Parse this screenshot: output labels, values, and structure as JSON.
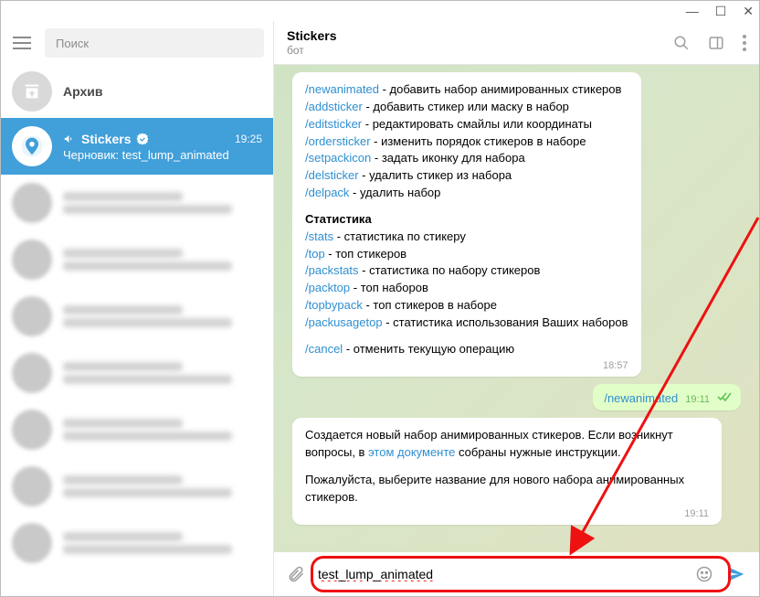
{
  "titlebar": {
    "min": "—",
    "max": "☐",
    "close": "✕"
  },
  "sidebar": {
    "search_placeholder": "Поиск",
    "archive": "Архив",
    "active_chat": {
      "name": "Stickers",
      "time": "19:25",
      "draft_prefix": "Черновик:",
      "draft_text": "test_lump_animated"
    }
  },
  "chat_header": {
    "title": "Stickers",
    "subtitle": "бот"
  },
  "bot_commands": [
    {
      "cmd": "/newanimated",
      "desc": " - добавить набор анимированных стикеров"
    },
    {
      "cmd": "/addsticker",
      "desc": " - добавить стикер или маску в набор"
    },
    {
      "cmd": "/editsticker",
      "desc": " - редактировать смайлы или координаты"
    },
    {
      "cmd": "/ordersticker",
      "desc": " - изменить порядок стикеров в наборе"
    },
    {
      "cmd": "/setpackicon",
      "desc": " - задать иконку для набора"
    },
    {
      "cmd": "/delsticker",
      "desc": " - удалить стикер из набора"
    },
    {
      "cmd": "/delpack",
      "desc": " - удалить набор"
    }
  ],
  "stats_header": "Статистика",
  "stats_commands": [
    {
      "cmd": "/stats",
      "desc": " - статистика по стикеру"
    },
    {
      "cmd": "/top",
      "desc": " - топ стикеров"
    },
    {
      "cmd": "/packstats",
      "desc": " - статистика по набору стикеров"
    },
    {
      "cmd": "/packtop",
      "desc": " - топ наборов"
    },
    {
      "cmd": "/topbypack",
      "desc": " - топ стикеров в наборе"
    },
    {
      "cmd": "/packusagetop",
      "desc": " - статистика использования Ваших наборов"
    }
  ],
  "cancel": {
    "cmd": "/cancel",
    "desc": " - отменить текущую операцию"
  },
  "msg1_time": "18:57",
  "outgoing": {
    "text": "/newanimated",
    "time": "19:11"
  },
  "reply": {
    "p1a": "Создается новый набор анимированных стикеров. Если возникнут вопросы, в ",
    "p1link": "этом документе",
    "p1b": " собраны нужные инструкции.",
    "p2": "Пожалуйста, выберите название для нового набора анимированных стикеров.",
    "time": "19:11"
  },
  "composer": {
    "value": "test_lump_animated"
  }
}
